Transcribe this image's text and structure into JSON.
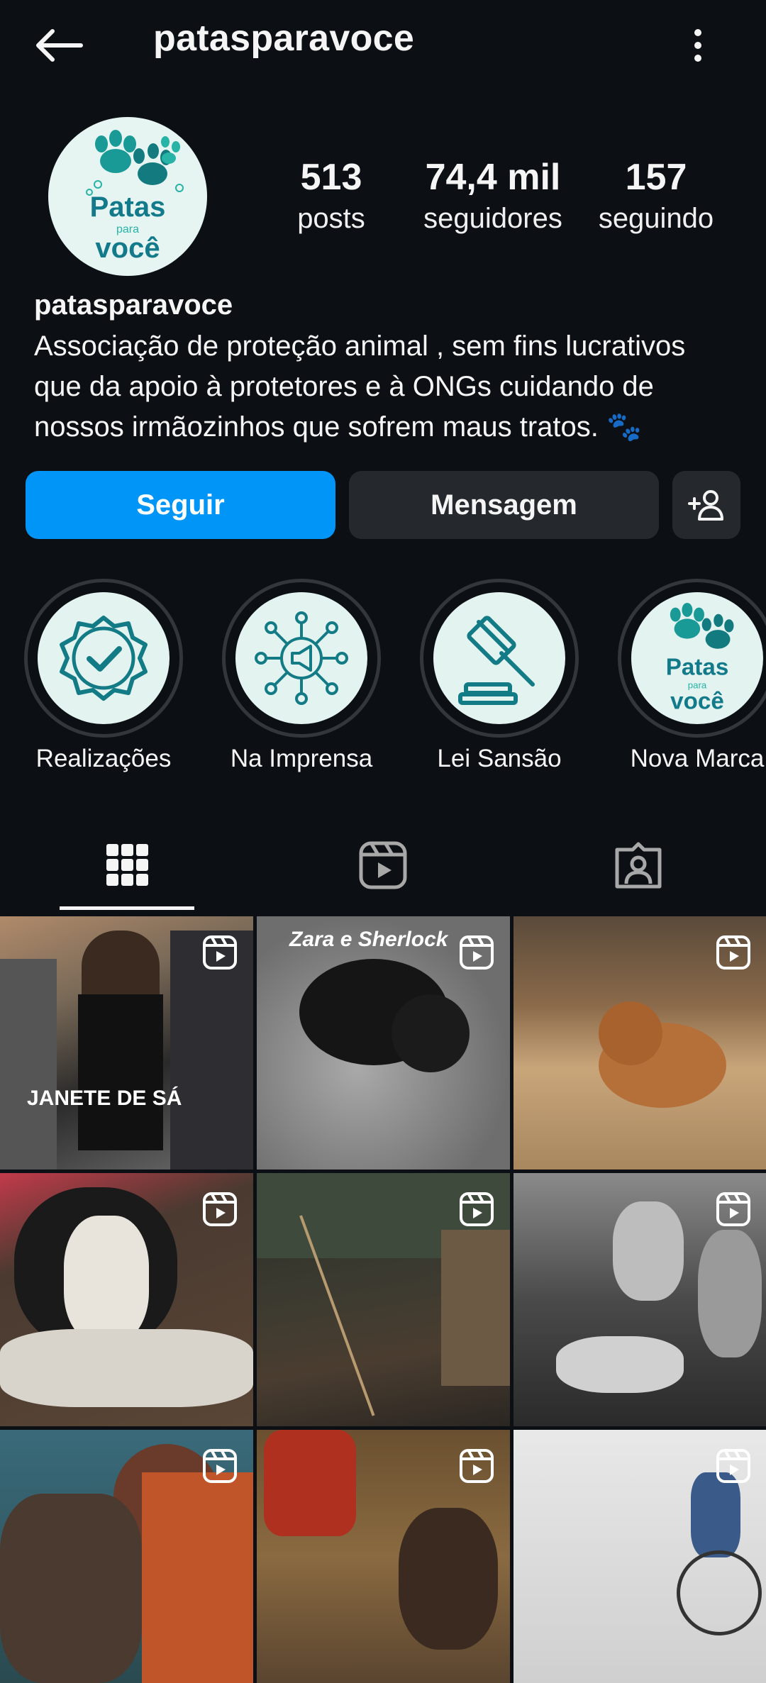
{
  "header": {
    "title": "patasparavoce"
  },
  "stats": [
    {
      "value": "513",
      "label": "posts"
    },
    {
      "value": "74,4 mil",
      "label": "seguidores"
    },
    {
      "value": "157",
      "label": "seguindo"
    }
  ],
  "profile": {
    "name": "patasparavoce",
    "bio_lines": [
      "Associação de proteção animal , sem fins lucrativos",
      "que da apoio à protetores e à ONGs cuidando de",
      "nossos irmãozinhos que sofrem maus tratos. 🐾"
    ],
    "logo_text": {
      "line1": "Patas",
      "line2": "para",
      "line3": "você"
    }
  },
  "actions": {
    "follow": "Seguir",
    "message": "Mensagem"
  },
  "highlights": [
    {
      "label": "Realizações",
      "icon": "check-badge-icon"
    },
    {
      "label": "Na Imprensa",
      "icon": "megaphone-network-icon"
    },
    {
      "label": "Lei Sansão",
      "icon": "gavel-icon"
    },
    {
      "label": "Nova Marca",
      "icon": "patas-logo"
    }
  ],
  "tabs": [
    {
      "name": "posts",
      "icon": "grid-icon",
      "active": true
    },
    {
      "name": "reels",
      "icon": "reels-icon",
      "active": false
    },
    {
      "name": "tagged",
      "icon": "tagged-icon",
      "active": false
    }
  ],
  "grid_posts": [
    {
      "overlay_text": "JANETE DE SÁ",
      "type": "reel"
    },
    {
      "overlay_text": "Zara e Sherlock",
      "type": "reel"
    },
    {
      "overlay_text": "",
      "type": "reel"
    },
    {
      "overlay_text": "",
      "type": "reel"
    },
    {
      "overlay_text": "",
      "type": "reel"
    },
    {
      "overlay_text": "",
      "type": "reel"
    },
    {
      "overlay_text": "",
      "type": "reel"
    },
    {
      "overlay_text": "",
      "type": "reel"
    },
    {
      "overlay_text": "",
      "type": "reel"
    }
  ],
  "colors": {
    "background": "#0c1014",
    "accent": "#0095f6",
    "button_secondary": "#25292e",
    "brand_teal": "#1a8a8a"
  }
}
